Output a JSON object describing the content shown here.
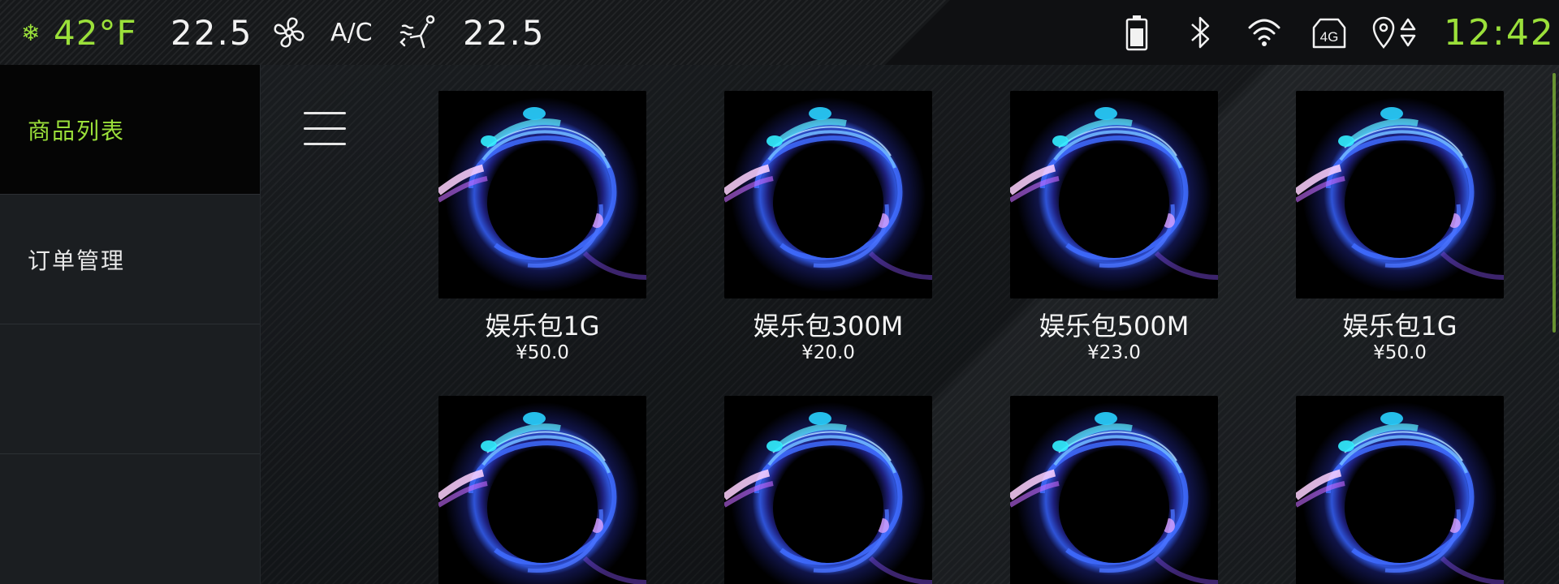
{
  "status_bar": {
    "outside_temp": "42°F",
    "left_temp": "22.5",
    "ac_label": "A/C",
    "right_temp": "22.5",
    "clock": "12:42",
    "lte_label": "4G",
    "icons": [
      "snowflake-icon",
      "fan-icon",
      "seat-airflow-icon",
      "battery-icon",
      "bluetooth-icon",
      "wifi-icon",
      "4g-icon",
      "location-icon",
      "sort-arrows-icon"
    ]
  },
  "sidebar": {
    "items": [
      {
        "label": "商品列表",
        "active": true
      },
      {
        "label": "订单管理",
        "active": false
      },
      {
        "label": "",
        "active": false
      },
      {
        "label": "",
        "active": false
      }
    ]
  },
  "products": [
    {
      "name": "娱乐包1G",
      "price": "¥50.0"
    },
    {
      "name": "娱乐包300M",
      "price": "¥20.0"
    },
    {
      "name": "娱乐包500M",
      "price": "¥23.0"
    },
    {
      "name": "娱乐包1G",
      "price": "¥50.0"
    },
    {
      "name": "",
      "price": ""
    },
    {
      "name": "",
      "price": ""
    },
    {
      "name": "",
      "price": ""
    },
    {
      "name": "",
      "price": ""
    }
  ],
  "colors": {
    "accent": "#9be03a",
    "text": "#ffffff",
    "background": "#16181a"
  }
}
